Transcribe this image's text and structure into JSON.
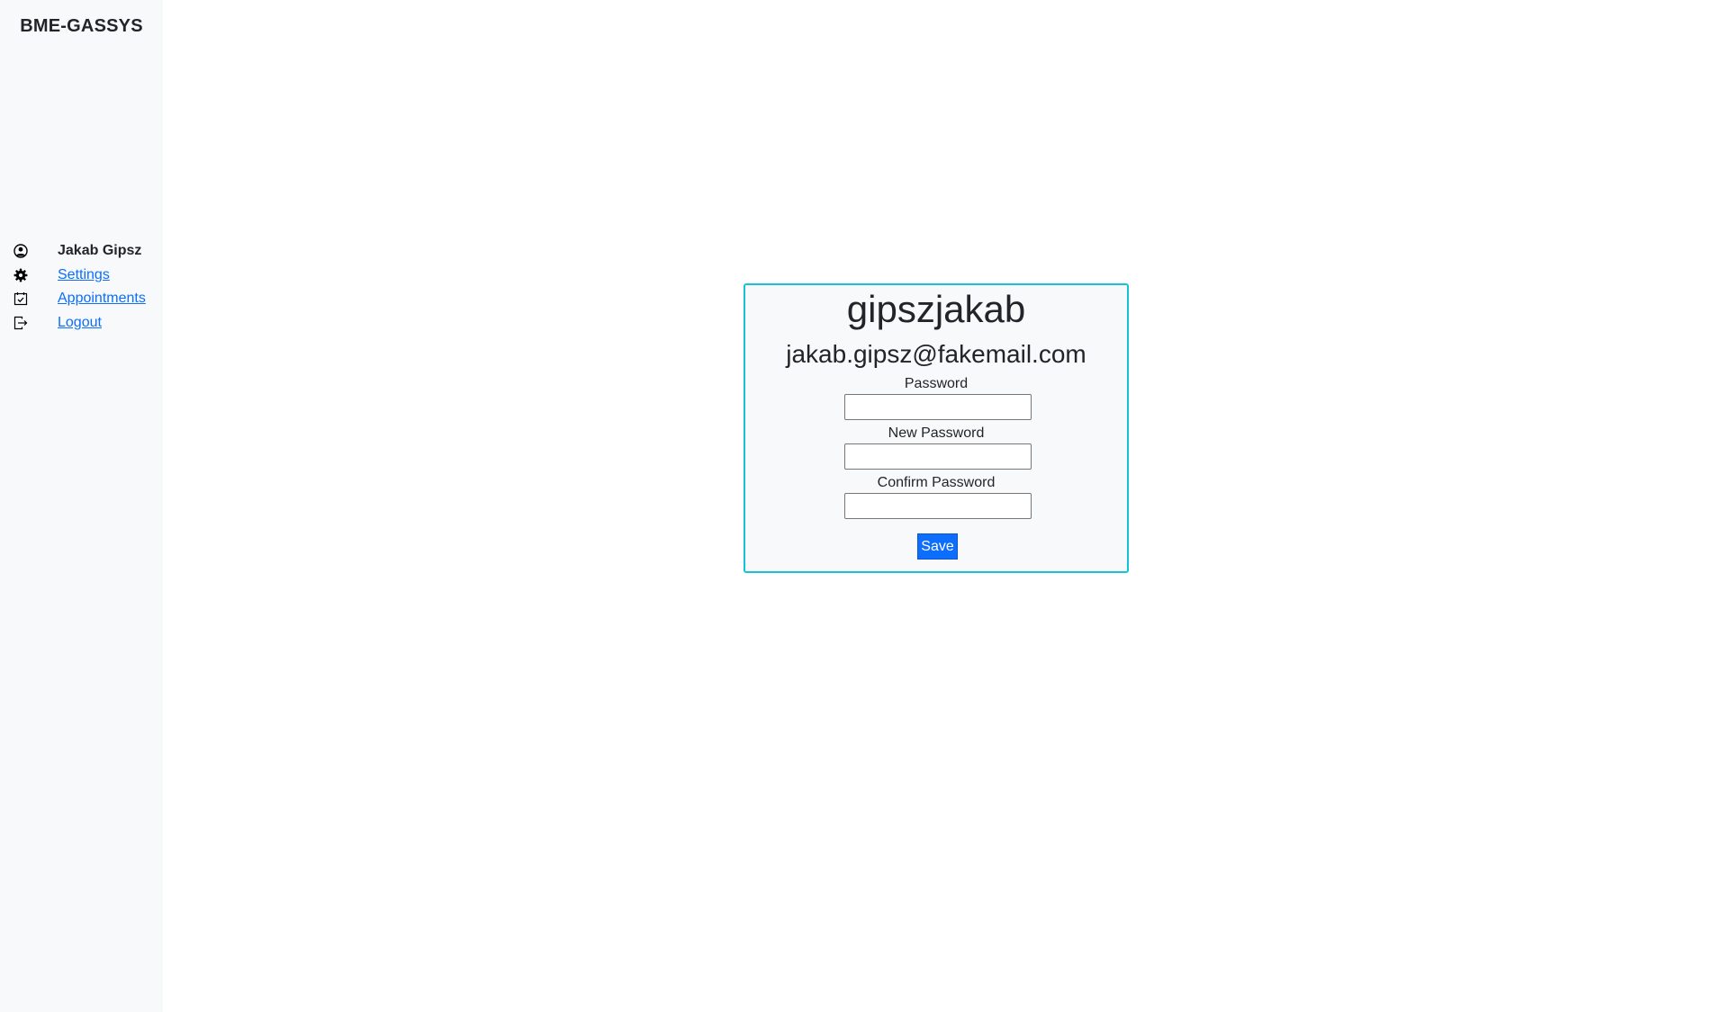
{
  "app": {
    "brand": "BME-GASSYS"
  },
  "sidebar": {
    "user_name": "Jakab Gipsz",
    "items": [
      {
        "label": "Settings",
        "icon": "gear-icon"
      },
      {
        "label": "Appointments",
        "icon": "calendar-check-icon"
      },
      {
        "label": "Logout",
        "icon": "logout-icon"
      }
    ],
    "user_icon": "user-circle-icon"
  },
  "profile": {
    "username": "gipszjakab",
    "email": "jakab.gipsz@fakemail.com",
    "password_label": "Password",
    "password_value": "",
    "new_password_label": "New Password",
    "new_password_value": "",
    "confirm_password_label": "Confirm Password",
    "confirm_password_value": "",
    "save_label": "Save"
  },
  "colors": {
    "accent": "#0d6efd",
    "card_border": "#17c1d6",
    "sidebar_bg": "#f8f9fa"
  }
}
